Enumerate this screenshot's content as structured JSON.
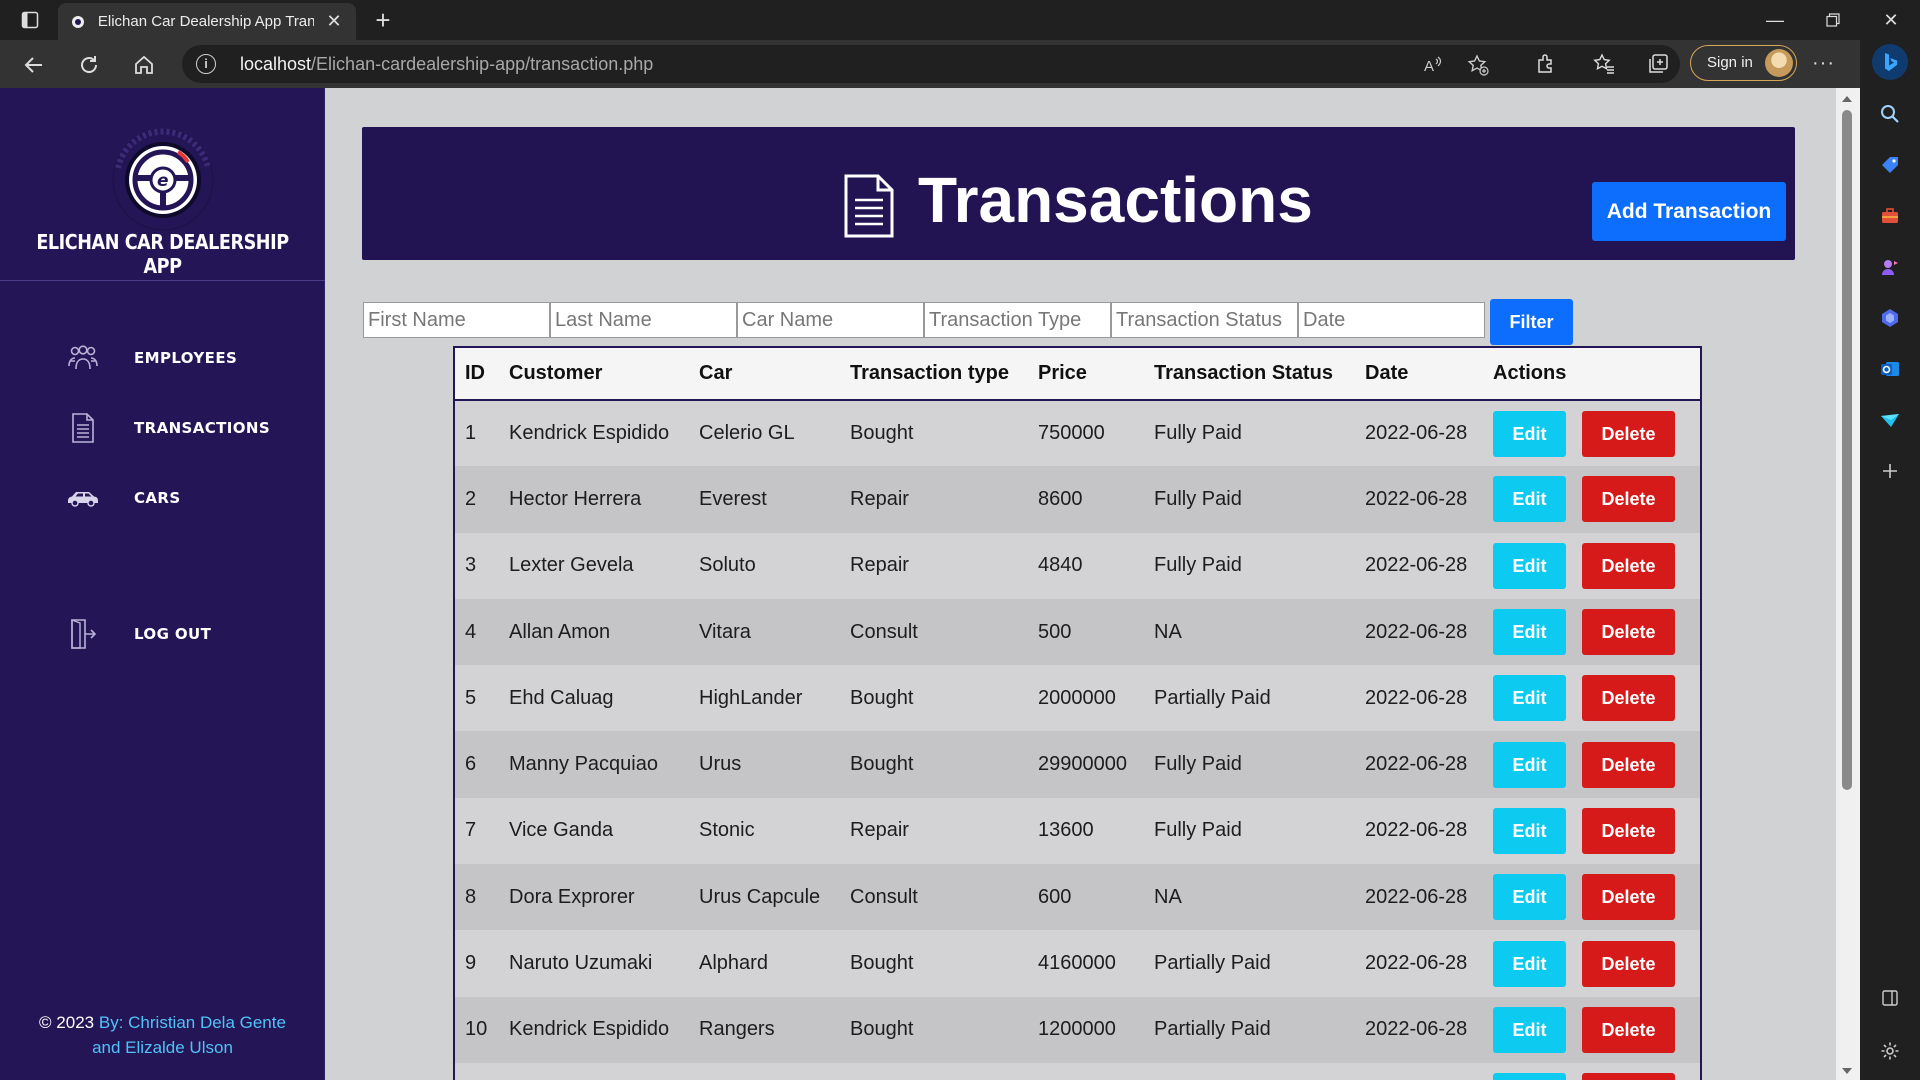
{
  "browser": {
    "tab_title": "Elichan Car Dealership App Transactions",
    "url_host": "localhost",
    "url_path": "/Elichan-cardealership-app/transaction.php",
    "signin_label": "Sign in"
  },
  "app": {
    "name": "ELICHAN CAR DEALERSHIP APP",
    "nav": [
      {
        "label": "EMPLOYEES",
        "icon": "employees-icon"
      },
      {
        "label": "TRANSACTIONS",
        "icon": "document-icon"
      },
      {
        "label": "CARS",
        "icon": "car-icon"
      },
      {
        "label": "LOG OUT",
        "icon": "logout-icon"
      }
    ],
    "credit_prefix": "© 2023",
    "credit_by": "By: Christian Dela Gente",
    "credit_line2": "and Elizalde Ulson"
  },
  "header": {
    "title": "Transactions",
    "add_button": "Add Transaction"
  },
  "filters": {
    "first_name": "First Name",
    "last_name": "Last Name",
    "car_name": "Car Name",
    "transaction_type": "Transaction Type",
    "transaction_status": "Transaction Status",
    "date": "Date",
    "button": "Filter"
  },
  "table": {
    "columns": [
      "ID",
      "Customer",
      "Car",
      "Transaction type",
      "Price",
      "Transaction Status",
      "Date",
      "Actions"
    ],
    "edit_label": "Edit",
    "delete_label": "Delete",
    "rows": [
      {
        "id": "1",
        "customer": "Kendrick Espidido",
        "car": "Celerio GL",
        "type": "Bought",
        "price": "750000",
        "status": "Fully Paid",
        "date": "2022-06-28"
      },
      {
        "id": "2",
        "customer": "Hector Herrera",
        "car": "Everest",
        "type": "Repair",
        "price": "8600",
        "status": "Fully Paid",
        "date": "2022-06-28"
      },
      {
        "id": "3",
        "customer": "Lexter Gevela",
        "car": "Soluto",
        "type": "Repair",
        "price": "4840",
        "status": "Fully Paid",
        "date": "2022-06-28"
      },
      {
        "id": "4",
        "customer": "Allan Amon",
        "car": "Vitara",
        "type": "Consult",
        "price": "500",
        "status": "NA",
        "date": "2022-06-28"
      },
      {
        "id": "5",
        "customer": "Ehd Caluag",
        "car": "HighLander",
        "type": "Bought",
        "price": "2000000",
        "status": "Partially Paid",
        "date": "2022-06-28"
      },
      {
        "id": "6",
        "customer": "Manny Pacquiao",
        "car": "Urus",
        "type": "Bought",
        "price": "29900000",
        "status": "Fully Paid",
        "date": "2022-06-28"
      },
      {
        "id": "7",
        "customer": "Vice Ganda",
        "car": "Stonic",
        "type": "Repair",
        "price": "13600",
        "status": "Fully Paid",
        "date": "2022-06-28"
      },
      {
        "id": "8",
        "customer": "Dora Exprorer",
        "car": "Urus Capcule",
        "type": "Consult",
        "price": "600",
        "status": "NA",
        "date": "2022-06-28"
      },
      {
        "id": "9",
        "customer": "Naruto Uzumaki",
        "car": "Alphard",
        "type": "Bought",
        "price": "4160000",
        "status": "Partially Paid",
        "date": "2022-06-28"
      },
      {
        "id": "10",
        "customer": "Kendrick Espidido",
        "car": "Rangers",
        "type": "Bought",
        "price": "1200000",
        "status": "Partially Paid",
        "date": "2022-06-28"
      }
    ]
  },
  "colors": {
    "sidebar_bg": "#241556",
    "header_bg": "#221452",
    "primary": "#0d6efd",
    "edit": "#0dcaf0",
    "delete": "#d61a1a"
  }
}
